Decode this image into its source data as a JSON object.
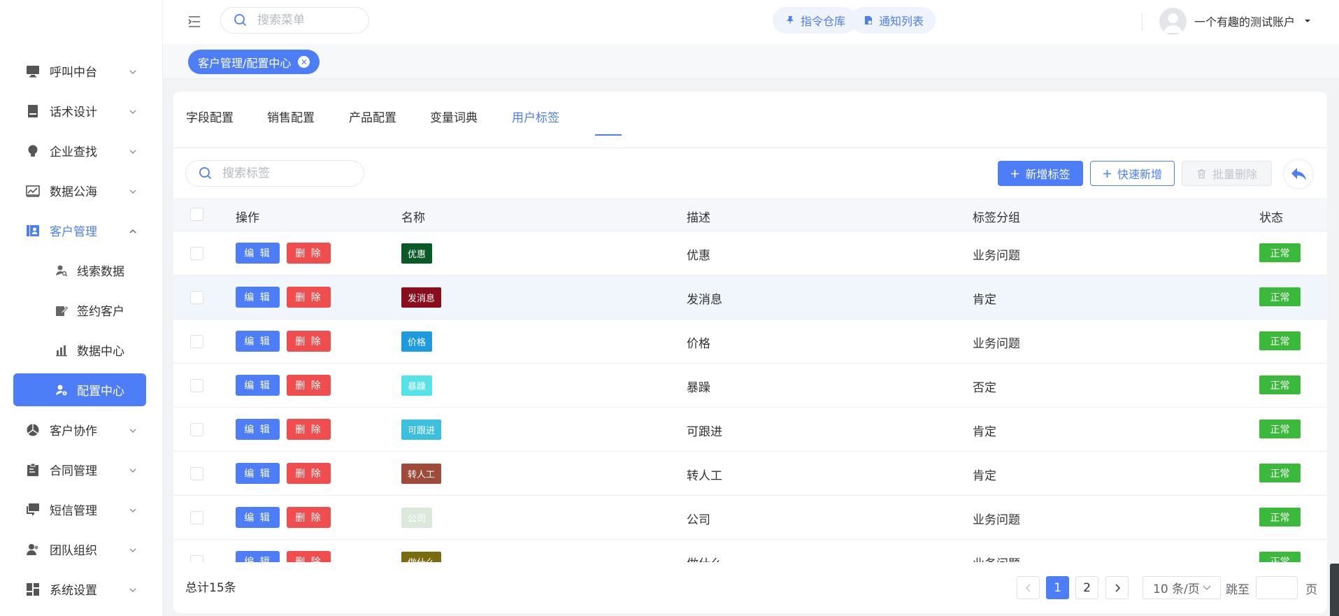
{
  "sidebar": {
    "items": [
      {
        "label": "呼叫中台",
        "icon": "monitor-icon"
      },
      {
        "label": "话术设计",
        "icon": "book-icon"
      },
      {
        "label": "企业查找",
        "icon": "bulb-icon"
      },
      {
        "label": "数据公海",
        "icon": "chart-icon"
      },
      {
        "label": "客户管理",
        "icon": "contacts-icon",
        "open": true
      },
      {
        "label": "线索数据",
        "icon": "user-search-icon",
        "sub": true
      },
      {
        "label": "签约客户",
        "icon": "edit-icon",
        "sub": true
      },
      {
        "label": "数据中心",
        "icon": "bar-chart-icon",
        "sub": true
      },
      {
        "label": "配置中心",
        "icon": "user-gear-icon",
        "sub": true,
        "active": true
      },
      {
        "label": "客户协作",
        "icon": "pie-icon"
      },
      {
        "label": "合同管理",
        "icon": "clipboard-icon"
      },
      {
        "label": "短信管理",
        "icon": "message-icon"
      },
      {
        "label": "团队组织",
        "icon": "team-icon"
      },
      {
        "label": "系统设置",
        "icon": "grid-icon"
      }
    ]
  },
  "topbar": {
    "search_placeholder": "搜索菜单",
    "btn_commands": "指令仓库",
    "btn_notices": "通知列表",
    "user_name": "一个有趣的测试账户"
  },
  "visited_tag": "客户管理/配置中心",
  "tabs": [
    "字段配置",
    "销售配置",
    "产品配置",
    "变量词典",
    "用户标签"
  ],
  "active_tab": "用户标签",
  "toolbar": {
    "search_placeholder": "搜索标签",
    "add_label": "新增标签",
    "quick_add_label": "快速新增",
    "batch_delete_label": "批量删除"
  },
  "table": {
    "headers": [
      "操作",
      "名称",
      "描述",
      "标签分组",
      "状态"
    ],
    "edit_label": "编 辑",
    "delete_label": "删 除",
    "rows": [
      {
        "name": "优惠",
        "color": "#0a5a28",
        "desc": "优惠",
        "group": "业务问题",
        "status": "正常"
      },
      {
        "name": "发消息",
        "color": "#8a0d1e",
        "desc": "发消息",
        "group": "肯定",
        "status": "正常"
      },
      {
        "name": "价格",
        "color": "#1d9ae0",
        "desc": "价格",
        "group": "业务问题",
        "status": "正常"
      },
      {
        "name": "暴躁",
        "color": "#56e3e8",
        "desc": "暴躁",
        "group": "否定",
        "status": "正常"
      },
      {
        "name": "可跟进",
        "color": "#3cc0e0",
        "desc": "可跟进",
        "group": "肯定",
        "status": "正常"
      },
      {
        "name": "转人工",
        "color": "#a04a3a",
        "desc": "转人工",
        "group": "肯定",
        "status": "正常"
      },
      {
        "name": "公司",
        "color": "#dde8dd",
        "desc": "公司",
        "group": "业务问题",
        "status": "正常"
      },
      {
        "name": "做什么",
        "color": "#7a6a10",
        "desc": "做什么",
        "group": "业务问题",
        "status": "正常"
      }
    ]
  },
  "pagination": {
    "total": "总计15条",
    "pages": [
      "1",
      "2"
    ],
    "current": "1",
    "page_size": "10 条/页",
    "jump_label": "跳至",
    "page_unit": "页"
  }
}
